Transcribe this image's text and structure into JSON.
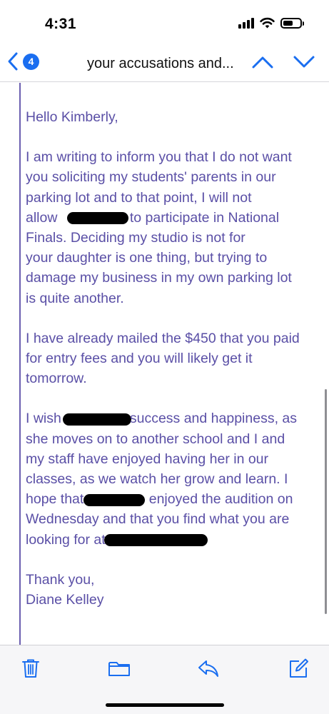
{
  "status": {
    "time": "4:31"
  },
  "nav": {
    "back_count": "4",
    "title": "your accusations and..."
  },
  "email": {
    "greeting": "Hello Kimberly,",
    "p1": [
      "I am writing to inform you that I do not want",
      "you soliciting my students' parents in our",
      "parking lot and to that point, I will not",
      [
        "allow ",
        "to participate in National"
      ],
      "Finals. Deciding my studio is not for",
      "your daughter is one thing, but trying to",
      "damage my business in my own parking lot",
      "is quite another."
    ],
    "p2": [
      "I have already mailed the $450 that you paid",
      "for entry fees and you will likely get it",
      "tomorrow."
    ],
    "p3": [
      [
        "I wish",
        "success and happiness, as"
      ],
      "she moves on to another school and I and",
      "my staff have enjoyed having her in our",
      "classes, as we watch her grow and learn. I",
      [
        "hope that",
        " enjoyed the audition on"
      ],
      "Wednesday and that you find what you are",
      [
        "looking for at",
        ""
      ]
    ],
    "closing": "Thank you,",
    "signature": "Diane Kelley"
  },
  "colors": {
    "accent": "#1a6ef0",
    "quoted_text": "#5a4fa6",
    "quote_bar": "#6b5fb0"
  },
  "toolbar": {
    "icons": [
      "trash-icon",
      "folder-icon",
      "reply-icon",
      "compose-icon"
    ]
  }
}
